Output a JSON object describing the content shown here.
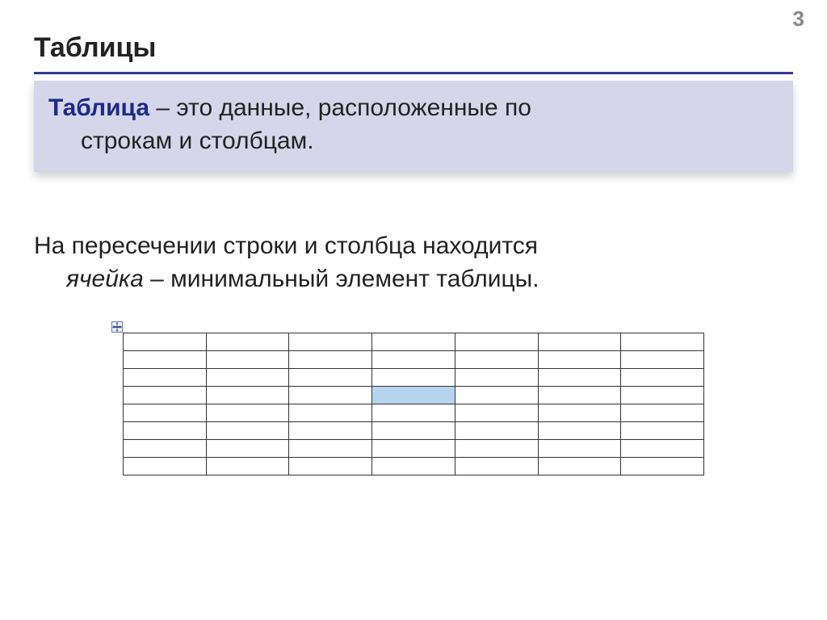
{
  "page_number": "3",
  "title": "Таблицы",
  "definition": {
    "term": "Таблица",
    "line1_rest": " – это данные, расположенные по",
    "line2": "строкам и столбцам."
  },
  "body": {
    "line1": "На пересечении строки и столбца находится",
    "cell_term": "ячейка",
    "line2_rest": " – минимальный элемент таблицы."
  },
  "table": {
    "rows": 8,
    "cols": 7,
    "selected": {
      "row": 3,
      "col": 3
    }
  },
  "icons": {
    "move_handle": "move-icon"
  },
  "colors": {
    "accent": "#2f3d8f",
    "definition_bg": "#d5d6ea",
    "selected_cell": "#b7d4ef"
  }
}
